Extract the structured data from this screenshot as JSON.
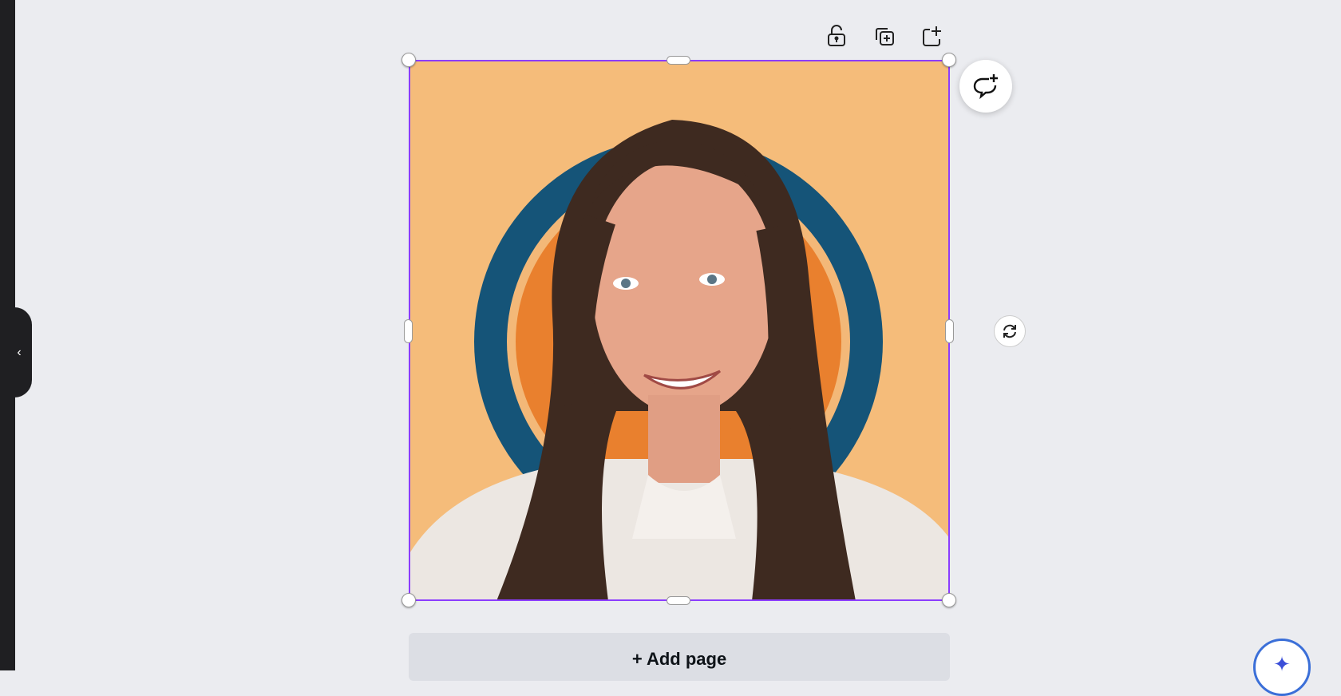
{
  "canvas": {
    "add_page_label": "+ Add page",
    "selection_color": "#8B3DFF",
    "background_color": "#F5BC7A",
    "ring_color": "#155478",
    "inner_circle_color": "#E9802E"
  },
  "sidebar": {
    "collapse_glyph": "‹"
  },
  "toolbar_icons": [
    "lock-icon",
    "duplicate-icon",
    "add-page-icon"
  ],
  "magic": {
    "glyph": "✦"
  }
}
